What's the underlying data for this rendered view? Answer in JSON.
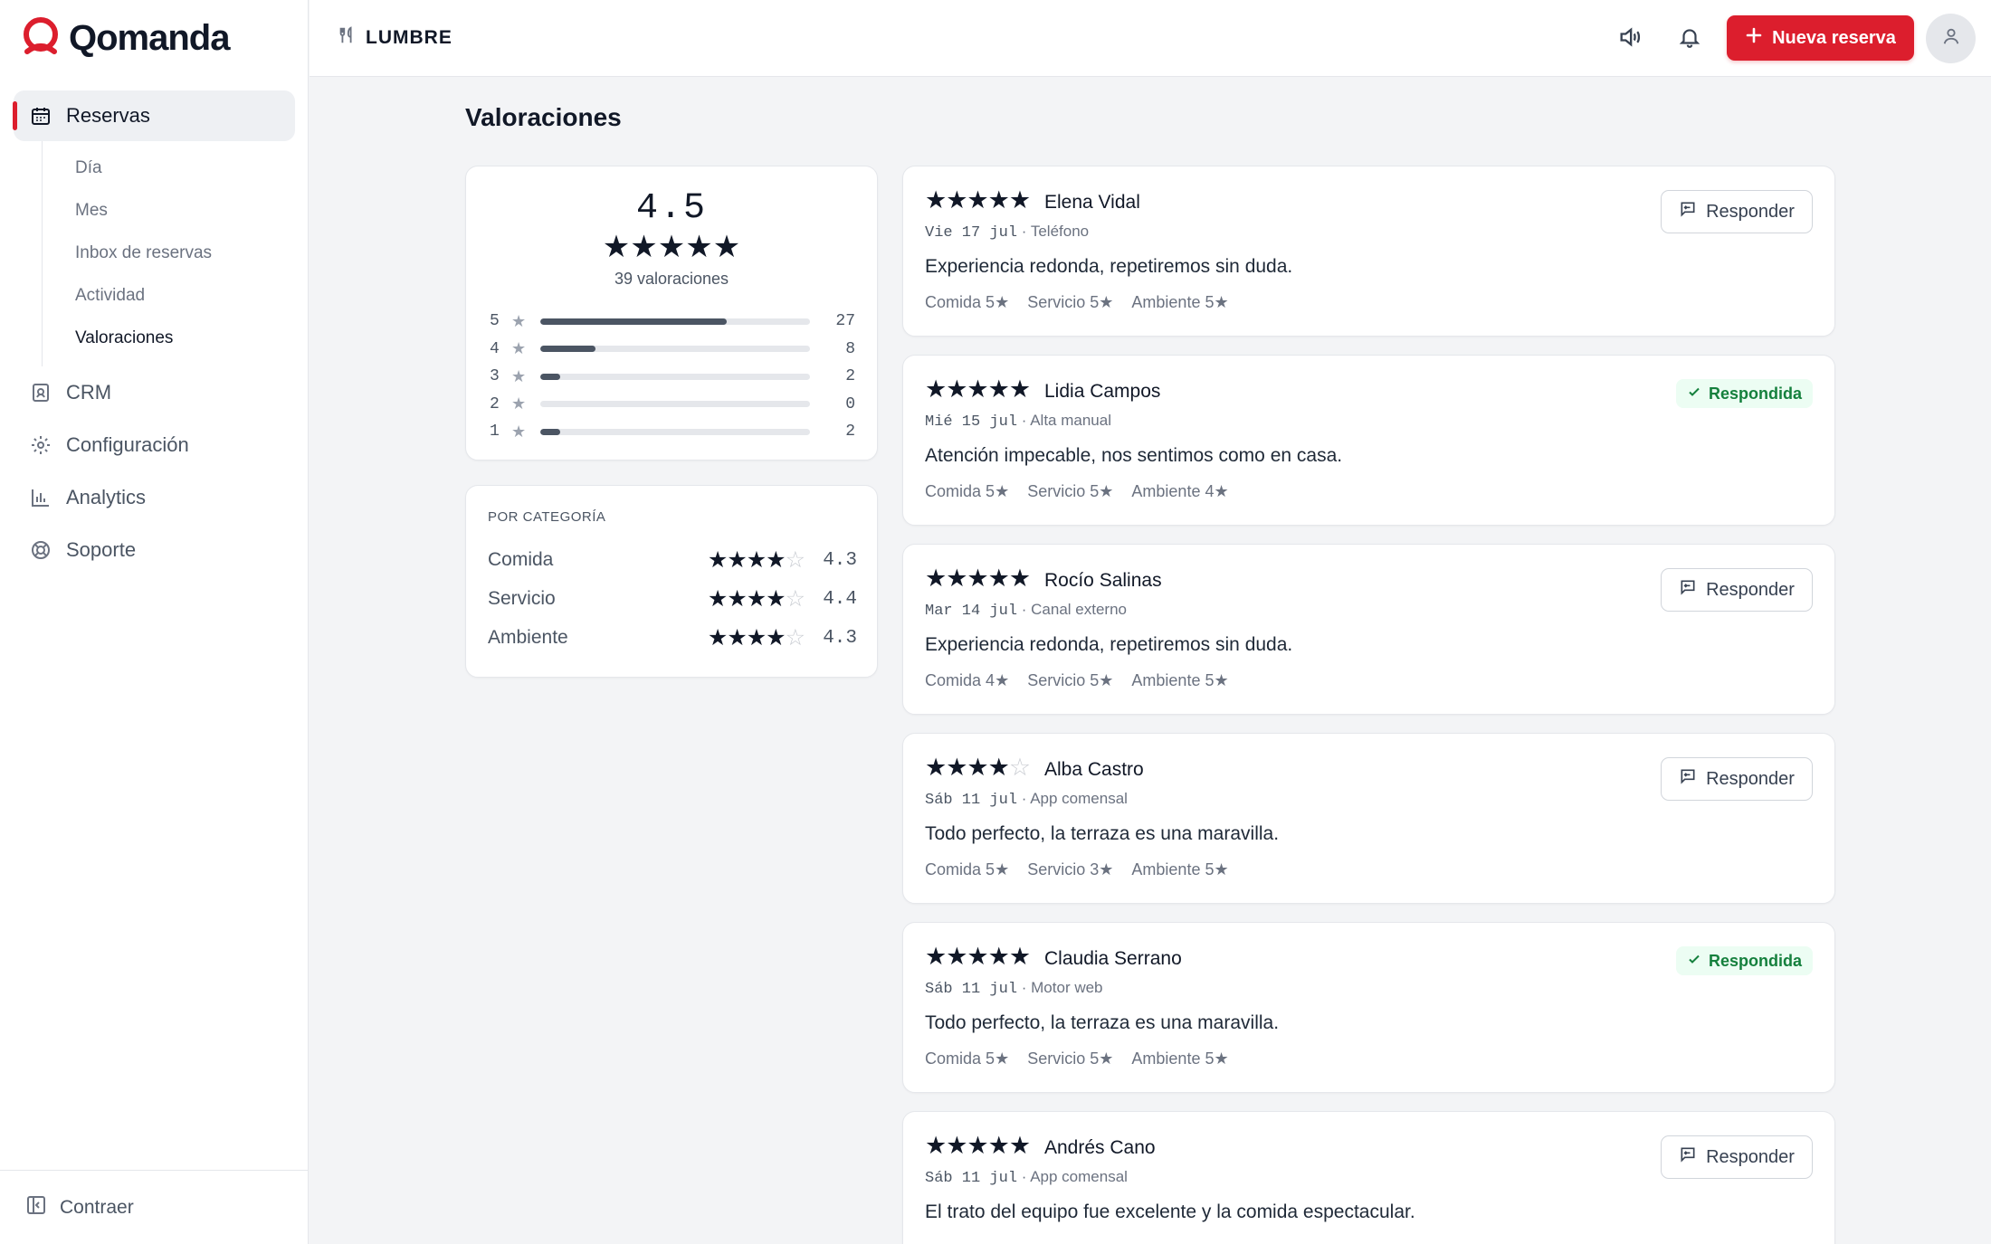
{
  "app": {
    "brand": "Qomanda",
    "venue": "LUMBRE",
    "new_reservation": "Nueva reserva",
    "accent_color": "#dc1e2d"
  },
  "sidebar": {
    "reservas": "Reservas",
    "sub": [
      "Día",
      "Mes",
      "Inbox de reservas",
      "Actividad",
      "Valoraciones"
    ],
    "crm": "CRM",
    "config": "Configuración",
    "analytics": "Analytics",
    "soporte": "Soporte",
    "collapse": "Contraer"
  },
  "page": {
    "title": "Valoraciones"
  },
  "summary": {
    "average": "4.5",
    "average_stars": "★★★★★",
    "total_label": "39 valoraciones",
    "distribution": [
      {
        "stars": "5",
        "count": "27",
        "fraction": 0.6923
      },
      {
        "stars": "4",
        "count": "8",
        "fraction": 0.2051
      },
      {
        "stars": "3",
        "count": "2",
        "fraction": 0.0513
      },
      {
        "stars": "2",
        "count": "0",
        "fraction": 0
      },
      {
        "stars": "1",
        "count": "2",
        "fraction": 0.0513
      }
    ]
  },
  "categories": {
    "title": "POR CATEGORÍA",
    "items": [
      {
        "name": "Comida",
        "value": "4.3",
        "filled": 4
      },
      {
        "name": "Servicio",
        "value": "4.4",
        "filled": 4
      },
      {
        "name": "Ambiente",
        "value": "4.3",
        "filled": 4
      }
    ]
  },
  "labels": {
    "respond": "Responder",
    "answered": "Respondida",
    "comida": "Comida",
    "servicio": "Servicio",
    "ambiente": "Ambiente",
    "star": "★"
  },
  "reviews": [
    {
      "rating": 5,
      "name": "Elena Vidal",
      "date": "Vie 17 jul",
      "source": "· Teléfono",
      "text": "Experiencia redonda, repetiremos sin duda.",
      "comida": "5",
      "servicio": "5",
      "ambiente": "5",
      "answered": false
    },
    {
      "rating": 5,
      "name": "Lidia Campos",
      "date": "Mié 15 jul",
      "source": "· Alta manual",
      "text": "Atención impecable, nos sentimos como en casa.",
      "comida": "5",
      "servicio": "5",
      "ambiente": "4",
      "answered": true
    },
    {
      "rating": 5,
      "name": "Rocío Salinas",
      "date": "Mar 14 jul",
      "source": "· Canal externo",
      "text": "Experiencia redonda, repetiremos sin duda.",
      "comida": "4",
      "servicio": "5",
      "ambiente": "5",
      "answered": false
    },
    {
      "rating": 4,
      "name": "Alba Castro",
      "date": "Sáb 11 jul",
      "source": "· App comensal",
      "text": "Todo perfecto, la terraza es una maravilla.",
      "comida": "5",
      "servicio": "3",
      "ambiente": "5",
      "answered": false
    },
    {
      "rating": 5,
      "name": "Claudia Serrano",
      "date": "Sáb 11 jul",
      "source": "· Motor web",
      "text": "Todo perfecto, la terraza es una maravilla.",
      "comida": "5",
      "servicio": "5",
      "ambiente": "5",
      "answered": true
    },
    {
      "rating": 5,
      "name": "Andrés Cano",
      "date": "Sáb 11 jul",
      "source": "· App comensal",
      "text": "El trato del equipo fue excelente y la comida espectacular.",
      "comida": "",
      "servicio": "",
      "ambiente": "",
      "answered": false
    }
  ]
}
